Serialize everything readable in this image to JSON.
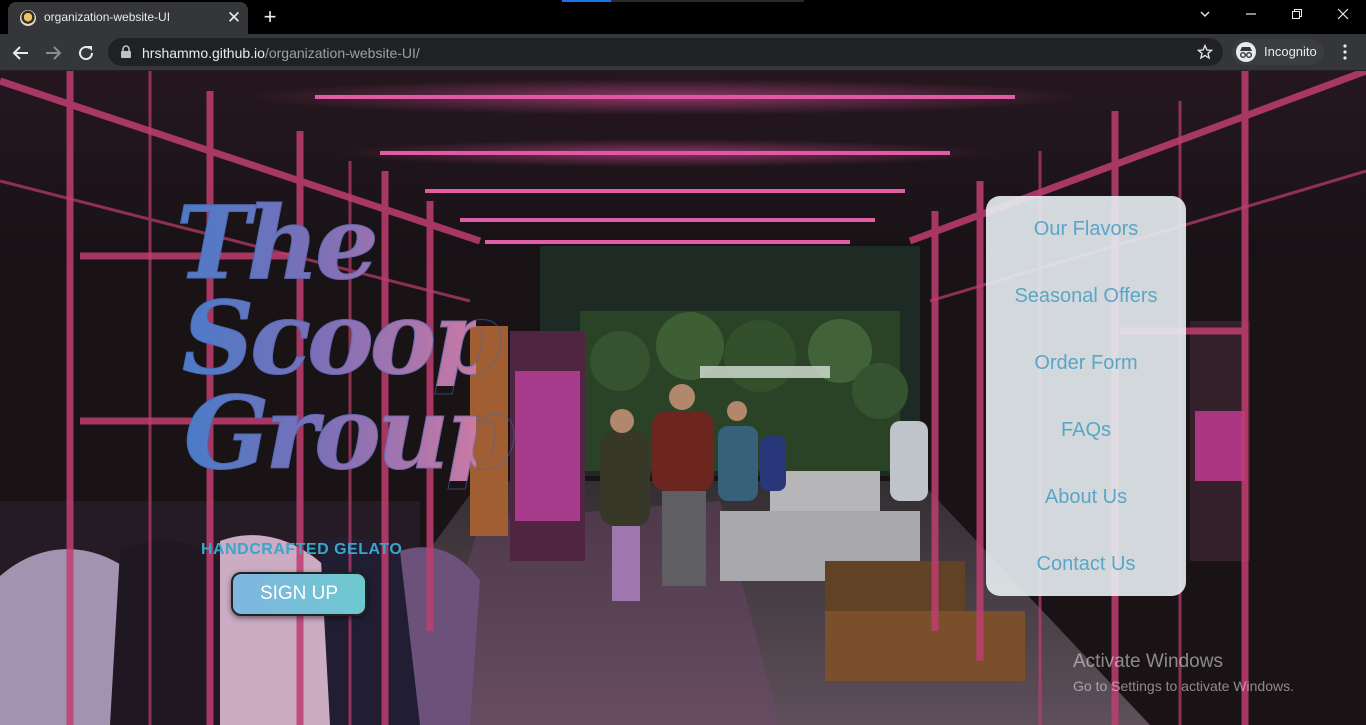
{
  "browser": {
    "tab_title": "organization-website-UI",
    "url_host": "hrshammo.github.io",
    "url_path": "/organization-website-UI/",
    "profile_label": "Incognito"
  },
  "icons": {
    "favicon": "gelato-favicon-icon",
    "tab_close": "close-icon",
    "new_tab": "plus-icon",
    "back": "arrow-left-icon",
    "forward": "arrow-right-icon",
    "reload": "reload-icon",
    "lock": "lock-icon",
    "bookmark": "star-icon",
    "incognito": "incognito-icon",
    "menu": "kebab-menu-icon"
  },
  "hero": {
    "logo_lines": [
      "The",
      "Scoop",
      "Group"
    ],
    "tagline": "HANDCRAFTED GELATO",
    "signup_label": "SIGN UP"
  },
  "nav": {
    "items": [
      {
        "label": "Our Flavors"
      },
      {
        "label": "Seasonal Offers"
      },
      {
        "label": "Order Form"
      },
      {
        "label": "FAQs"
      },
      {
        "label": "About Us"
      },
      {
        "label": "Contact Us"
      }
    ]
  },
  "watermark": {
    "title": "Activate Windows",
    "subtitle": "Go to Settings to activate Windows."
  },
  "colors": {
    "tab_bg": "#35363a",
    "toolbar_bg": "#35363a",
    "omnibox_bg": "#202124",
    "neon_pink": "#ff4fa8",
    "nav_text": "#5aa6c6",
    "logo_gradient_start": "#4a7cc8",
    "logo_gradient_end": "#c97aa5"
  }
}
